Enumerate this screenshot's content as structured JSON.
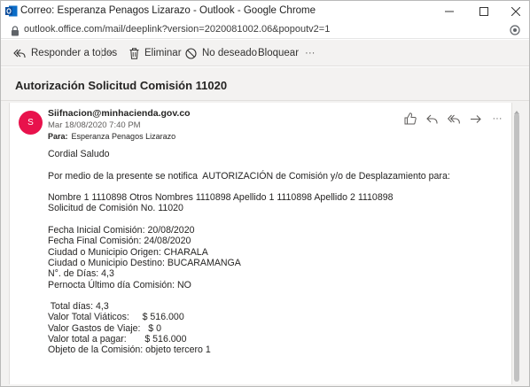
{
  "browser": {
    "title": "Correo: Esperanza Penagos Lizarazo - Outlook - Google Chrome",
    "url": "outlook.office.com/mail/deeplink?version=2020081002.06&popoutv2=1"
  },
  "toolbar": {
    "reply_all_label": "Responder a todos",
    "delete_label": "Eliminar",
    "junk_label": "No deseado",
    "block_label": "Bloquear",
    "more_label": "···"
  },
  "message": {
    "subject": "Autorización Solicitud Comisión 11020",
    "avatar_initial": "S",
    "avatar_color": "#e8124c",
    "sender": "Siifnacion@minhacienda.gov.co",
    "date": "Mar 18/08/2020 7:40 PM",
    "to_label": "Para:",
    "to_value": "Esperanza Penagos Lizarazo",
    "body_lines": [
      "Cordial Saludo",
      "",
      "Por medio de la presente se notifica  AUTORIZACIÓN de Comisión y/o de Desplazamiento para:",
      "",
      "Nombre 1 1110898 Otros Nombres 1110898 Apellido 1 1110898 Apellido 2 1110898",
      "Solicitud de Comisión No. 11020",
      "",
      "Fecha Inicial Comisión: 20/08/2020",
      "Fecha Final Comisión: 24/08/2020",
      "Ciudad o Municipio Origen: CHARALA",
      "Ciudad o Municipio Destino: BUCARAMANGA",
      "N°. de Días: 4,3",
      "Pernocta Último día Comisión: NO",
      "",
      " Total días: 4,3",
      "Valor Total Viáticos:     $ 516.000",
      "Valor Gastos de Viaje:   $ 0",
      "Valor total a pagar:       $ 516.000",
      "Objeto de la Comisión: objeto tercero 1"
    ]
  },
  "icons": {
    "app": "outlook-icon",
    "lock": "lock-icon",
    "reply_all": "reply-all-icon",
    "delete": "trash-icon",
    "junk": "block-circle-icon",
    "like": "thumbs-up-icon",
    "reply": "reply-icon",
    "forward": "forward-icon"
  }
}
